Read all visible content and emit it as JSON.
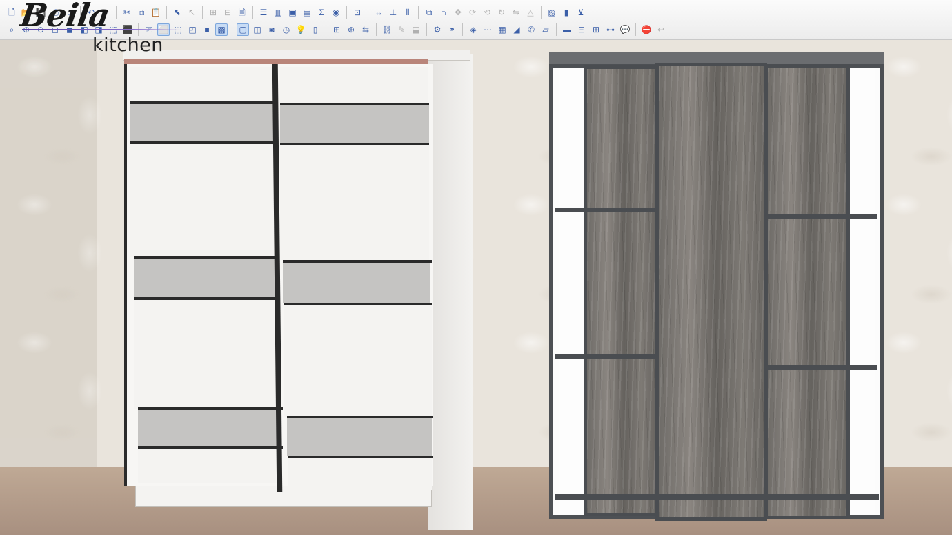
{
  "logo": {
    "script": "Beila",
    "sub": "kitchen"
  },
  "toolbar": {
    "row1": [
      {
        "name": "new-file-icon",
        "glyph": "🗋"
      },
      {
        "name": "open-file-icon",
        "glyph": "📂"
      },
      {
        "name": "save-icon",
        "glyph": "💾"
      },
      {
        "name": "print-icon",
        "glyph": "⎙"
      },
      {
        "name": "home-icon",
        "glyph": "⌂"
      },
      {
        "name": "undo-icon",
        "glyph": "↶"
      },
      {
        "name": "redo-icon",
        "glyph": "↷"
      },
      {
        "name": "cut-icon",
        "glyph": "✂"
      },
      {
        "name": "copy-icon",
        "glyph": "⧉"
      },
      {
        "name": "paste-icon",
        "glyph": "📋"
      },
      {
        "name": "select-icon",
        "glyph": "⬉"
      },
      {
        "name": "pointer-icon",
        "glyph": "↖"
      },
      {
        "name": "group-icon",
        "glyph": "⊞"
      },
      {
        "name": "ungroup-icon",
        "glyph": "⊟"
      },
      {
        "name": "properties-icon",
        "glyph": "🖹"
      },
      {
        "name": "tree-icon",
        "glyph": "☰"
      },
      {
        "name": "panel-icon",
        "glyph": "▥"
      },
      {
        "name": "material-icon",
        "glyph": "▣"
      },
      {
        "name": "cabinet-icon",
        "glyph": "▤"
      },
      {
        "name": "sum-icon",
        "glyph": "Σ"
      },
      {
        "name": "eye-icon",
        "glyph": "◉"
      },
      {
        "name": "layout-icon",
        "glyph": "⊡"
      },
      {
        "name": "dimension-icon",
        "glyph": "↔"
      },
      {
        "name": "align-icon",
        "glyph": "⊥"
      },
      {
        "name": "distribute-icon",
        "glyph": "⫴"
      },
      {
        "name": "overlap-icon",
        "glyph": "⧉"
      },
      {
        "name": "magnet-icon",
        "glyph": "∩"
      },
      {
        "name": "move-icon",
        "glyph": "✥"
      },
      {
        "name": "rotate-icon",
        "glyph": "⟳"
      },
      {
        "name": "rotate-left-icon",
        "glyph": "⟲"
      },
      {
        "name": "rotate-right-icon",
        "glyph": "↻"
      },
      {
        "name": "mirror-icon",
        "glyph": "⇋"
      },
      {
        "name": "triangle-icon",
        "glyph": "△"
      },
      {
        "name": "image-icon",
        "glyph": "▨"
      },
      {
        "name": "chart-icon",
        "glyph": "▮"
      },
      {
        "name": "anchor-icon",
        "glyph": "⊻"
      }
    ],
    "row2": [
      {
        "name": "zoom-fit-icon",
        "glyph": "⌕"
      },
      {
        "name": "zoom-in-icon",
        "glyph": "⊕"
      },
      {
        "name": "zoom-out-icon",
        "glyph": "⊖"
      },
      {
        "name": "view-front-icon",
        "glyph": "◻"
      },
      {
        "name": "view-top-icon",
        "glyph": "◼"
      },
      {
        "name": "view-left-icon",
        "glyph": "◧"
      },
      {
        "name": "view-right-icon",
        "glyph": "◨"
      },
      {
        "name": "view-iso-icon",
        "glyph": "⬚"
      },
      {
        "name": "view-3d-icon",
        "glyph": "⬛"
      },
      {
        "name": "projection-icon",
        "glyph": "⎚"
      },
      {
        "name": "wireframe-icon",
        "glyph": "⬜"
      },
      {
        "name": "hidden-lines-icon",
        "glyph": "⬚"
      },
      {
        "name": "shaded-icon",
        "glyph": "◰"
      },
      {
        "name": "solid-icon",
        "glyph": "■"
      },
      {
        "name": "textured-icon",
        "glyph": "▩"
      },
      {
        "name": "window-icon",
        "glyph": "▢"
      },
      {
        "name": "split-view-icon",
        "glyph": "◫"
      },
      {
        "name": "camera-icon",
        "glyph": "◙"
      },
      {
        "name": "clock-icon",
        "glyph": "◷"
      },
      {
        "name": "light-icon",
        "glyph": "💡"
      },
      {
        "name": "door-icon",
        "glyph": "▯"
      },
      {
        "name": "add-part-icon",
        "glyph": "⊞"
      },
      {
        "name": "insert-icon",
        "glyph": "⊕"
      },
      {
        "name": "replace-icon",
        "glyph": "⇆"
      },
      {
        "name": "link-icon",
        "glyph": "⛓"
      },
      {
        "name": "edit-icon",
        "glyph": "✎"
      },
      {
        "name": "edge-icon",
        "glyph": "⬓"
      },
      {
        "name": "tools-icon",
        "glyph": "⚙"
      },
      {
        "name": "chain-icon",
        "glyph": "⚭"
      },
      {
        "name": "texture-icon",
        "glyph": "◈"
      },
      {
        "name": "cut-list-icon",
        "glyph": "⋯"
      },
      {
        "name": "drawer-icon",
        "glyph": "▦"
      },
      {
        "name": "handle-icon",
        "glyph": "◢"
      },
      {
        "name": "phone-icon",
        "glyph": "✆"
      },
      {
        "name": "eraser-icon",
        "glyph": "▱"
      },
      {
        "name": "plank-icon",
        "glyph": "▬"
      },
      {
        "name": "table-icon",
        "glyph": "⊟"
      },
      {
        "name": "grid-icon",
        "glyph": "⊞"
      },
      {
        "name": "measure-icon",
        "glyph": "⊶"
      },
      {
        "name": "comment-icon",
        "glyph": "💬"
      },
      {
        "name": "stop-icon",
        "glyph": "⛔"
      },
      {
        "name": "back-icon",
        "glyph": "↩"
      }
    ]
  },
  "colors": {
    "accent": "#3b5fa8",
    "rail": "#b9857a",
    "frame_dark": "#4a4d51",
    "gray_panel": "#c5c4c2"
  }
}
